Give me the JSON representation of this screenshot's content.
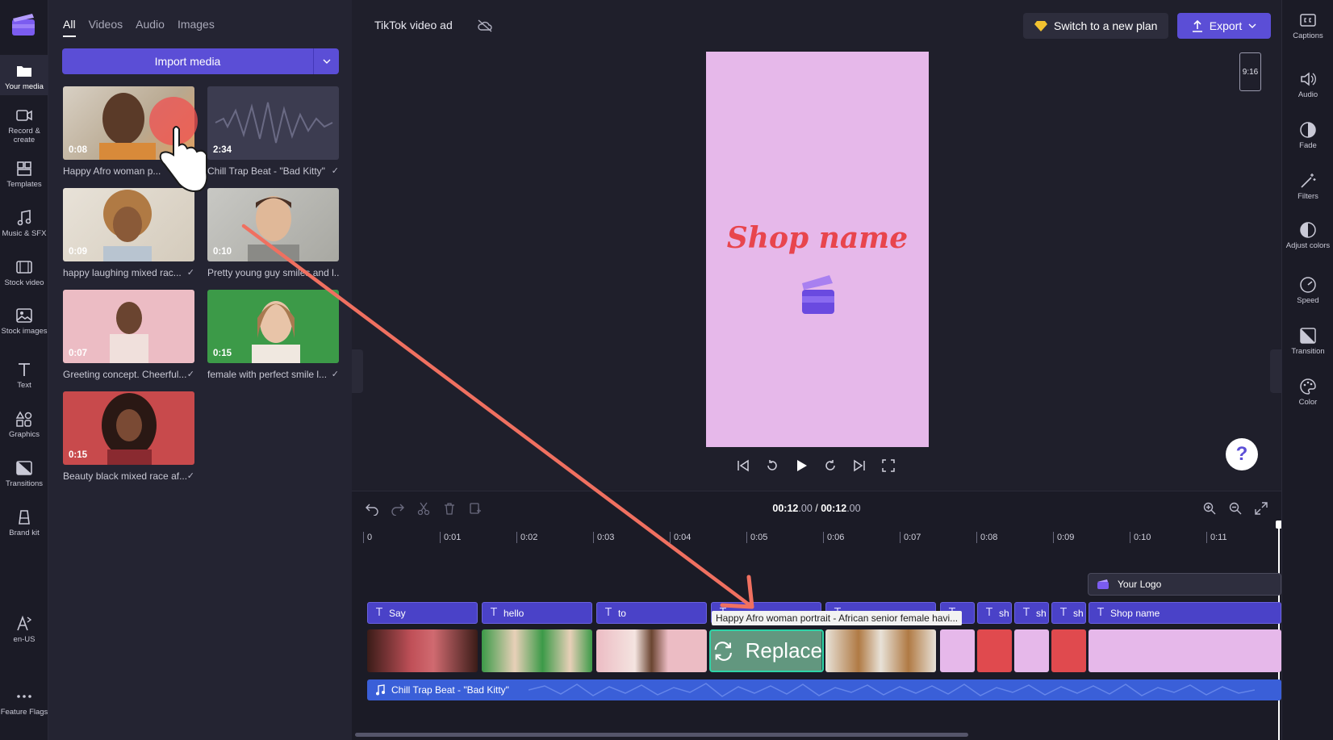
{
  "rail": {
    "items": [
      {
        "label": "Your media"
      },
      {
        "label": "Record & create"
      },
      {
        "label": "Templates"
      },
      {
        "label": "Music & SFX"
      },
      {
        "label": "Stock video"
      },
      {
        "label": "Stock images"
      },
      {
        "label": "Text"
      },
      {
        "label": "Graphics"
      },
      {
        "label": "Transitions"
      },
      {
        "label": "Brand kit"
      },
      {
        "label": "en-US"
      },
      {
        "label": "Feature Flags"
      }
    ]
  },
  "media": {
    "tabs": [
      "All",
      "Videos",
      "Audio",
      "Images"
    ],
    "import_label": "Import media",
    "items": [
      {
        "duration": "0:08",
        "caption": "Happy Afro woman p..."
      },
      {
        "duration": "2:34",
        "caption": "Chill Trap Beat - \"Bad Kitty\""
      },
      {
        "duration": "0:09",
        "caption": "happy laughing mixed rac..."
      },
      {
        "duration": "0:10",
        "caption": "Pretty young guy smiles and l..."
      },
      {
        "duration": "0:07",
        "caption": "Greeting concept. Cheerful..."
      },
      {
        "duration": "0:15",
        "caption": "female with perfect smile l..."
      },
      {
        "duration": "0:15",
        "caption": "Beauty black mixed race af..."
      }
    ]
  },
  "header": {
    "project_title": "TikTok video ad",
    "plan_label": "Switch to a new plan",
    "export_label": "Export"
  },
  "preview": {
    "aspect_ratio": "9:16",
    "shop_text": "Shop name"
  },
  "timeline": {
    "time_current": "00:12",
    "time_current_frac": ".00",
    "time_sep": " / ",
    "time_total": "00:12",
    "time_total_frac": ".00",
    "ruler": [
      "0",
      "0:01",
      "0:02",
      "0:03",
      "0:04",
      "0:05",
      "0:06",
      "0:07",
      "0:08",
      "0:09",
      "0:10",
      "0:11"
    ],
    "logo_track": "Your Logo",
    "text_clips": [
      "Say",
      "hello",
      "to",
      "",
      "",
      "",
      "sh",
      "sh",
      "sh",
      "Shop name"
    ],
    "audio_track": "Chill Trap Beat - \"Bad Kitty\"",
    "tooltip": "Happy Afro woman portrait - African senior female havi...",
    "replace_label": "Replace"
  },
  "right_panel": {
    "items": [
      {
        "label": "Captions"
      },
      {
        "label": "Audio"
      },
      {
        "label": "Fade"
      },
      {
        "label": "Filters"
      },
      {
        "label": "Adjust colors"
      },
      {
        "label": "Speed"
      },
      {
        "label": "Transition"
      },
      {
        "label": "Color"
      }
    ]
  },
  "help_label": "?",
  "colors": {
    "accent": "#5b4ed6",
    "text_clip": "#4a42c8",
    "audio_clip": "#3a5fd8",
    "preview_bg": "#e6b8ea",
    "shop_text": "#e8454d",
    "replace_border": "#2fd4a8",
    "annotation_arrow": "#f07060"
  }
}
